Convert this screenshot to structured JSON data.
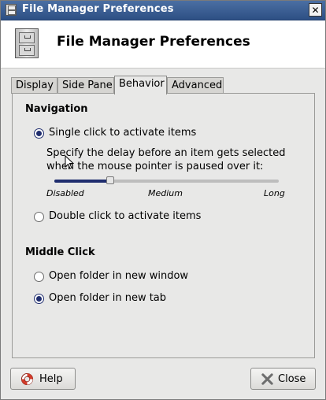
{
  "window": {
    "title": "File Manager Preferences",
    "icon": "file-cabinet-icon",
    "close_glyph": "✕"
  },
  "header": {
    "title": "File Manager Preferences",
    "icon": "file-cabinet-icon"
  },
  "tabs": [
    {
      "label": "Display",
      "active": false
    },
    {
      "label": "Side Pane",
      "active": false
    },
    {
      "label": "Behavior",
      "active": true
    },
    {
      "label": "Advanced",
      "active": false
    }
  ],
  "navigation": {
    "title": "Navigation",
    "single_click_label": "Single click to activate items",
    "single_click_selected": true,
    "delay_description_line1": "Specify the delay before an item gets selected",
    "delay_description_line2": "when the mouse pointer is paused over it:",
    "delay_slider": {
      "min_label": "Disabled",
      "mid_label": "Medium",
      "max_label": "Long",
      "value_fraction": 0.25
    },
    "double_click_label": "Double click to activate items",
    "double_click_selected": false
  },
  "middle_click": {
    "title": "Middle Click",
    "new_window_label": "Open folder in new window",
    "new_window_selected": false,
    "new_tab_label": "Open folder in new tab",
    "new_tab_selected": true
  },
  "buttons": {
    "help_label": "Help",
    "help_icon": "lifebuoy-icon",
    "close_label": "Close",
    "close_icon": "close-x-icon"
  },
  "colors": {
    "titlebar": "#2d4f84",
    "accent": "#1f2d6e",
    "help_icon_red": "#d23b2a",
    "close_icon_gray": "#6e6e6e"
  }
}
